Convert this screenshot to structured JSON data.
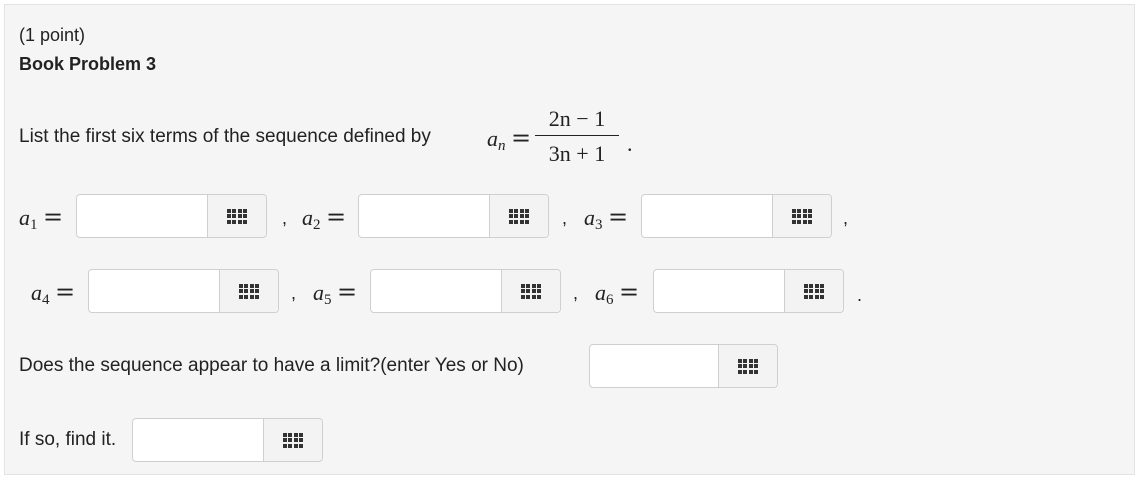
{
  "problem": {
    "points_label": "(1 point)",
    "title": "Book Problem 3",
    "intro_text": "List the first six terms of the sequence defined by",
    "formula": {
      "lhs_var": "a",
      "lhs_sub": "n",
      "equals": "=",
      "numerator": "2n − 1",
      "denominator": "3n + 1",
      "end_punct": "."
    }
  },
  "terms": [
    {
      "var": "a",
      "sub": "1",
      "value": "",
      "after": ","
    },
    {
      "var": "a",
      "sub": "2",
      "value": "",
      "after": ","
    },
    {
      "var": "a",
      "sub": "3",
      "value": "",
      "after": ","
    },
    {
      "var": "a",
      "sub": "4",
      "value": "",
      "after": ","
    },
    {
      "var": "a",
      "sub": "5",
      "value": "",
      "after": ","
    },
    {
      "var": "a",
      "sub": "6",
      "value": "",
      "after": "."
    }
  ],
  "limit_question": {
    "label": "Does the sequence appear to have a limit?(enter Yes or No)",
    "value": ""
  },
  "limit_value": {
    "label": "If so, find it.",
    "value": ""
  },
  "icons": {
    "equation_editor": "grid-icon"
  }
}
